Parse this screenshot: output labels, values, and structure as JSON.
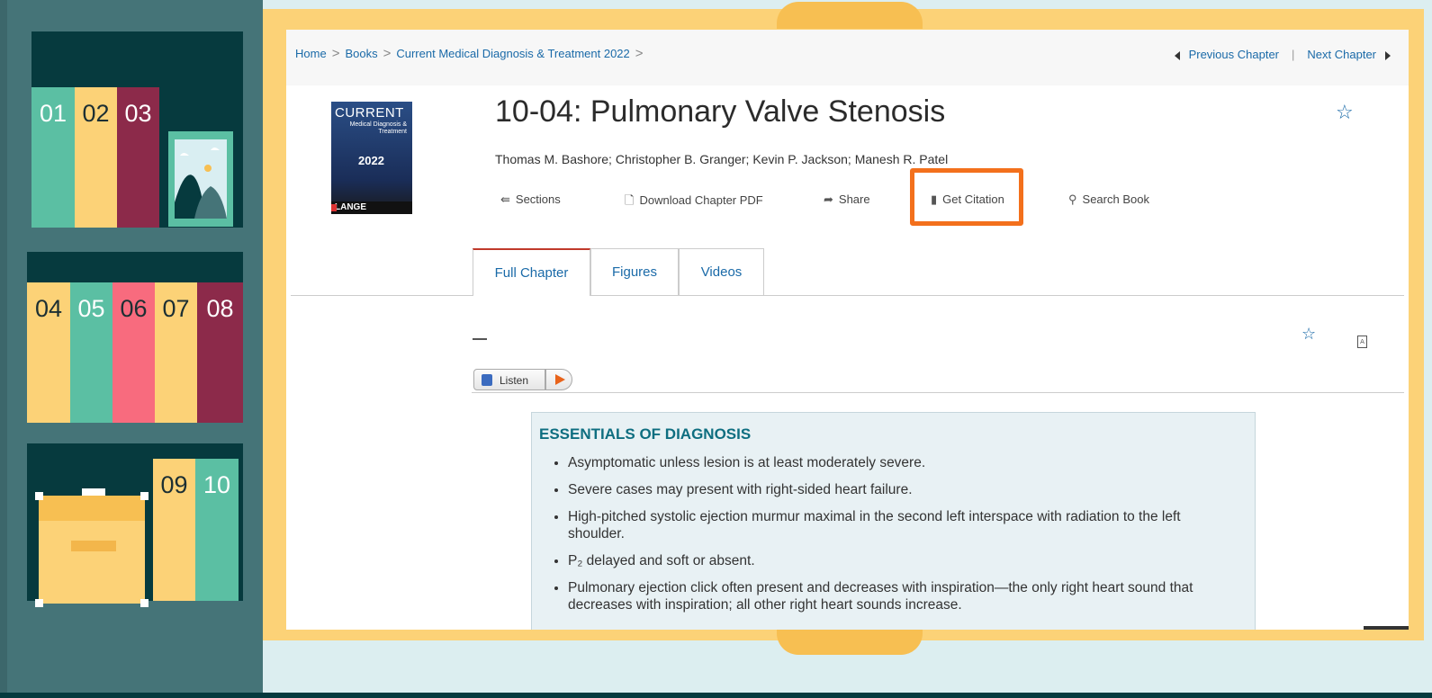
{
  "sidebar": {
    "shelf1_books": [
      "01",
      "02",
      "03"
    ],
    "shelf2_books": [
      "04",
      "05",
      "06",
      "07",
      "08"
    ],
    "shelf3_books": [
      "09",
      "10"
    ],
    "colors": {
      "teal": "#5bbfa3",
      "yellow": "#fcd277",
      "maroon": "#8c2a4a",
      "pink": "#f86b7e",
      "dark": "#063a3e"
    }
  },
  "breadcrumb": {
    "home": "Home",
    "books": "Books",
    "book": "Current Medical Diagnosis & Treatment 2022"
  },
  "chapter_nav": {
    "prev": "Previous Chapter",
    "next": "Next Chapter"
  },
  "cover": {
    "brand": "CURRENT",
    "subtitle": "Medical Diagnosis & Treatment",
    "year": "2022",
    "publisher": "LANGE"
  },
  "chapter": {
    "title": "10-04: Pulmonary Valve Stenosis",
    "authors": "Thomas M. Bashore; Christopher B. Granger; Kevin P. Jackson; Manesh R. Patel"
  },
  "toolbar": {
    "sections": "Sections",
    "download": "Download Chapter PDF",
    "share": "Share",
    "citation": "Get Citation",
    "search": "Search Book"
  },
  "tabs": {
    "full": "Full Chapter",
    "figures": "Figures",
    "videos": "Videos"
  },
  "listen": {
    "label": "Listen"
  },
  "essentials": {
    "heading": "ESSENTIALS OF DIAGNOSIS",
    "items": [
      "Asymptomatic unless lesion is at least moderately severe.",
      "Severe cases may present with right-sided heart failure.",
      "High-pitched systolic ejection murmur maximal in the second left interspace with radiation to the left shoulder.",
      "P₂ delayed and soft or absent.",
      "Pulmonary ejection click often present and decreases with inspiration—the only right heart sound that decreases with inspiration; all other right heart sounds increase."
    ]
  },
  "icons": [
    "star-icon",
    "pdf-icon",
    "share-icon",
    "citation-icon",
    "search-icon",
    "sections-icon",
    "speaker-icon",
    "play-icon"
  ]
}
